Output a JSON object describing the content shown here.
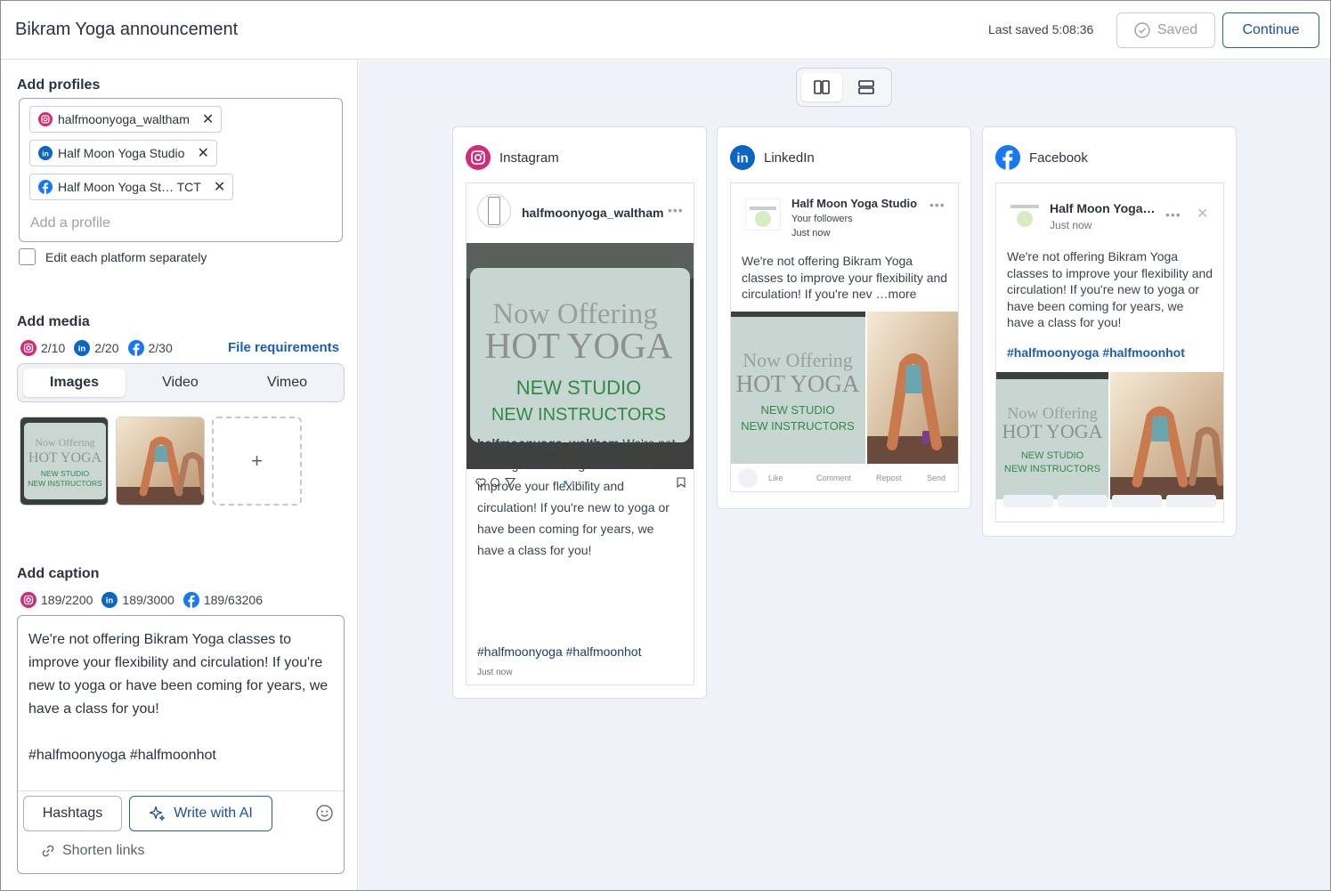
{
  "header": {
    "title": "Bikram Yoga announcement",
    "last_saved": "Last saved 5:08:36",
    "saved_label": "Saved",
    "continue_label": "Continue"
  },
  "profiles": {
    "section_title": "Add profiles",
    "chips": [
      {
        "platform": "instagram",
        "label": "halfmoonyoga_waltham"
      },
      {
        "platform": "linkedin",
        "label": "Half Moon Yoga Studio"
      },
      {
        "platform": "facebook",
        "label": "Half Moon Yoga St… TCT"
      }
    ],
    "placeholder": "Add a profile",
    "edit_separately_label": "Edit each platform separately"
  },
  "media": {
    "section_title": "Add media",
    "counts": {
      "instagram": "2/10",
      "linkedin": "2/20",
      "facebook": "2/30"
    },
    "file_requirements": "File requirements",
    "tabs": [
      "Images",
      "Video",
      "Vimeo"
    ],
    "active_tab": "Images",
    "add_symbol": "+"
  },
  "caption": {
    "section_title": "Add caption",
    "counts": {
      "instagram": "189/2200",
      "linkedin": "189/3000",
      "facebook": "189/63206"
    },
    "text": "We're not offering Bikram Yoga classes to improve your flexibility and circulation! If you're new to yoga or have been coming for years, we have a class for you!\n\n#halfmoonyoga #halfmoonhot",
    "hashtags_label": "Hashtags",
    "write_ai_label": "Write with AI",
    "shorten_links_label": "Shorten links"
  },
  "sign_image": {
    "line1": "Now Offering",
    "line2": "HOT YOGA",
    "line3": "NEW STUDIO",
    "line4": "NEW INSTRUCTORS"
  },
  "previews": {
    "instagram": {
      "platform_label": "Instagram",
      "username": "halfmoonyoga_waltham",
      "caption_user": "halfmoonyoga_waltham",
      "caption": "We're not offering Bikram Yoga classes to improve your flexibility and circulation! If you're new to yoga or have been coming for years, we have a class for you!",
      "hashtags": "#halfmoonyoga #halfmoonhot",
      "time": "Just now"
    },
    "linkedin": {
      "platform_label": "LinkedIn",
      "page_name": "Half Moon Yoga Studio",
      "audience": "Your followers",
      "time": "Just now",
      "caption": "We're not offering Bikram Yoga classes to improve your flexibility and circulation! If you're nev",
      "more": "…more",
      "actions": [
        "Like",
        "Comment",
        "Repost",
        "Send"
      ]
    },
    "facebook": {
      "platform_label": "Facebook",
      "page_name": "Half Moon Yoga…",
      "time": "Just now",
      "caption": "We're not offering Bikram Yoga classes to improve your flexibility and circulation! If you're new to yoga or have been coming for years, we have a class for you!",
      "hashtags": "#halfmoonyoga #halfmoonhot"
    }
  },
  "colors": {
    "accent_blue": "#1c5db8",
    "instagram": "#d62976",
    "linkedin": "#0a66c2",
    "facebook": "#1877f2",
    "preview_bg": "#eff2f8"
  }
}
